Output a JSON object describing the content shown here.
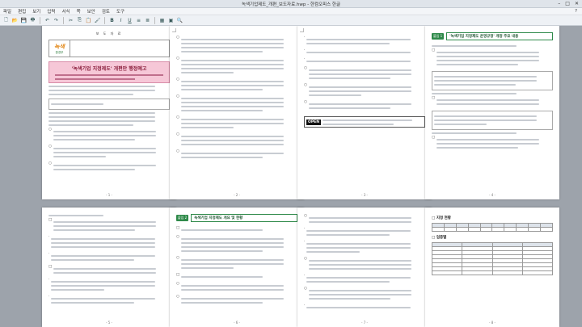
{
  "window": {
    "title": "녹색기업제도_개편_보도자료.hwp - 한컴오피스 한글",
    "controls": [
      "–",
      "□",
      "✕"
    ]
  },
  "menubar": {
    "items": [
      "파일",
      "편집",
      "보기",
      "입력",
      "서식",
      "쪽",
      "보안",
      "검토",
      "도구"
    ],
    "right": "?"
  },
  "toolbar": {
    "icons": [
      "new-document-icon",
      "open-folder-icon",
      "save-icon",
      "print-icon",
      "undo-icon",
      "redo-icon",
      "cut-icon",
      "copy-icon",
      "paste-icon",
      "format-painter-icon",
      "bold-icon",
      "italic-icon",
      "underline-icon",
      "align-left-icon",
      "align-center-icon",
      "table-icon",
      "image-icon",
      "zoom-icon"
    ],
    "glyphs": [
      "🗋",
      "📂",
      "💾",
      "🖶",
      "↶",
      "↷",
      "✂",
      "⎘",
      "📋",
      "🖌",
      "B",
      "I",
      "U",
      "≡",
      "≣",
      "▦",
      "▣",
      "🔍"
    ]
  },
  "pages": {
    "p1": {
      "press_title": "보 도 자 료",
      "logo_main": "녹색",
      "logo_sub": "환경부",
      "headline": "'녹색기업 지정제도' 개편안 행정예고",
      "page_number": "- 1 -"
    },
    "p2": {
      "page_number": "- 2 -"
    },
    "p3": {
      "stamp_label": "OPEN",
      "page_number": "- 3 -"
    },
    "p4": {
      "badge": "붙임 1",
      "section_title": "'녹색기업 지정제도 운영규정' 개정 주요 내용",
      "page_number": "- 4 -"
    },
    "p5": {
      "page_number": "- 5 -"
    },
    "p6": {
      "badge": "붙임 2",
      "section_title": "녹색기업 지정제도 개요 및 현황",
      "page_number": "- 6 -"
    },
    "p7": {
      "page_number": "- 7 -"
    },
    "p8": {
      "table1_title": "□ 지정 현황",
      "table2_title": "□ 업종별",
      "page_number": "- 8 -"
    }
  }
}
